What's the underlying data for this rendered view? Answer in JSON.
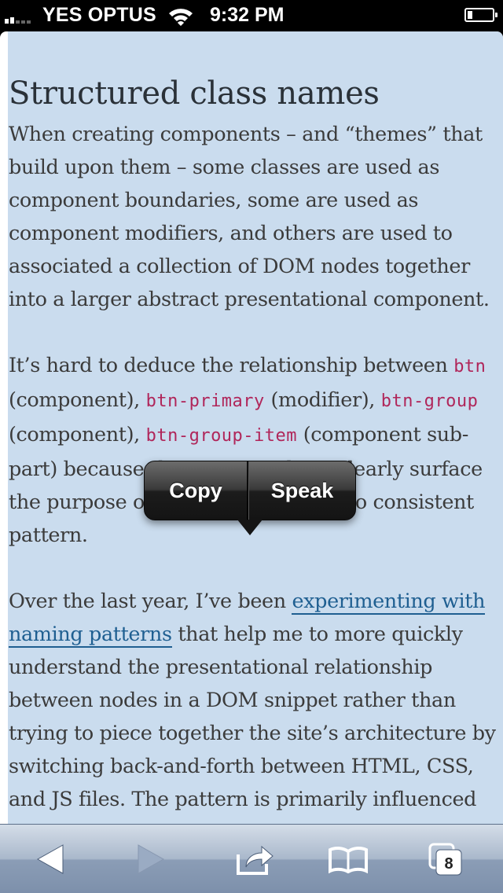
{
  "status_bar": {
    "carrier": "YES OPTUS",
    "time": "9:32 PM"
  },
  "article": {
    "heading": "Structured class names",
    "p1": "When creating components – and “themes” that build upon them – some classes are used as component boundaries, some are used as component modifiers, and others are used to associated a collection of DOM nodes together into a larger abstract presentational component.",
    "p2": {
      "t1": "It’s hard to deduce the relationship between ",
      "c1": "btn",
      "t2": " (component), ",
      "c2": "btn-primary",
      "t3": " (modifier), ",
      "c3": "btn-group",
      "t4": " (component), ",
      "c4": "btn-group-item",
      "t5": " (component sub-part) because these names don’t clearly surface the purpose of the class. There is no consistent pattern."
    },
    "p3": {
      "t1": "Over the last year, I’ve been ",
      "link": "experimenting with naming patterns",
      "t2": " that help me to more quickly understand the presentational relationship between nodes in a DOM snippet rather than trying to piece together the site’s architecture by switching back-and-forth between HTML, CSS, and JS files. The pattern is primarily influenced"
    }
  },
  "callout": {
    "copy": "Copy",
    "speak": "Speak"
  },
  "toolbar": {
    "tabs_count": "8"
  },
  "colors": {
    "selection": "#cadcee",
    "code": "#b0265a",
    "link": "#1f5f91"
  }
}
